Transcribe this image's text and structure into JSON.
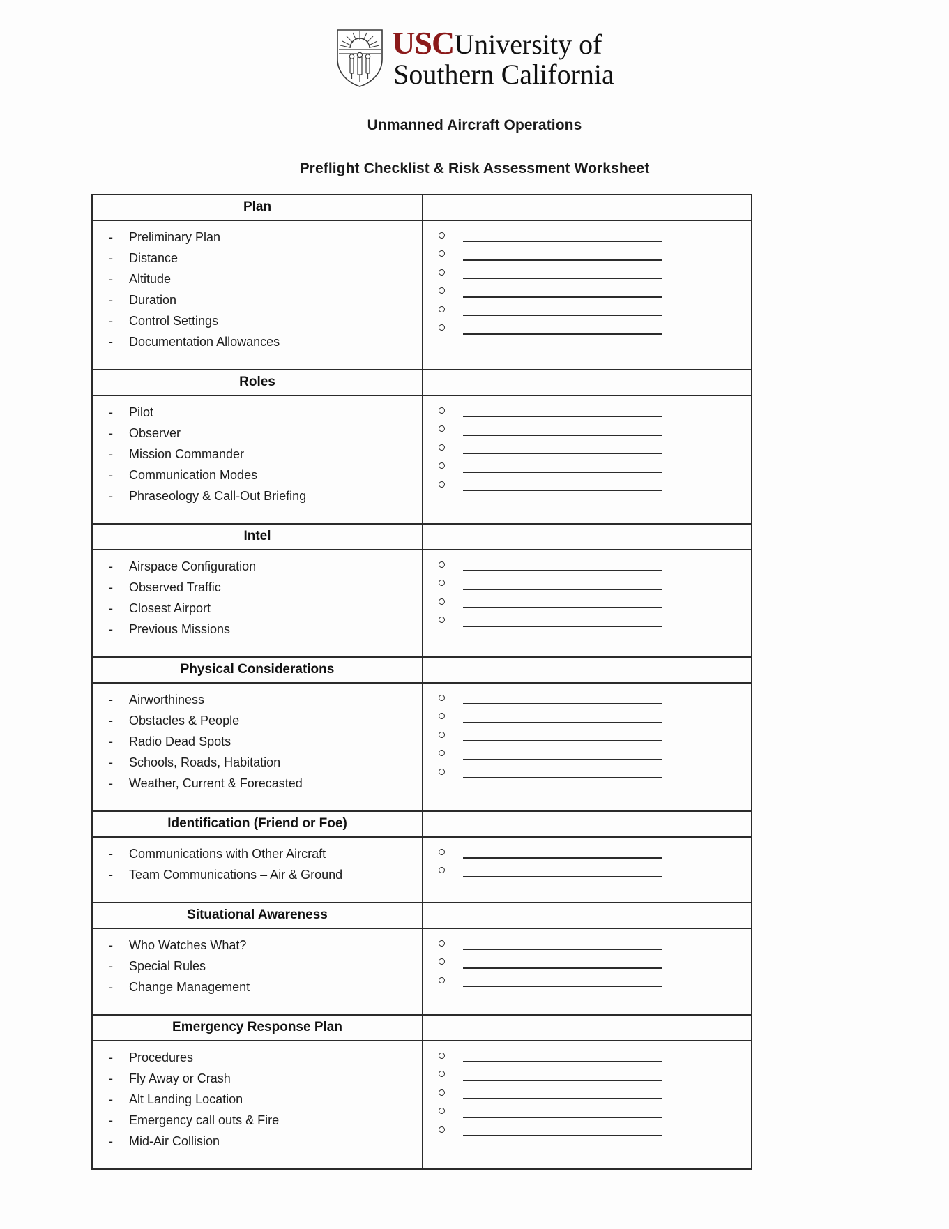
{
  "logo": {
    "usc_letters": "USC",
    "line1_rest": "University of",
    "line2": "Southern California",
    "shield_icon": "usc-shield-icon",
    "brand_color": "#8b1a1a"
  },
  "header": {
    "title": "Unmanned Aircraft Operations",
    "subtitle": "Preflight Checklist & Risk Assessment Worksheet"
  },
  "bullet_dash": "-",
  "sections": [
    {
      "heading": "Plan",
      "items": [
        "Preliminary Plan",
        "Distance",
        "Altitude",
        "Duration",
        "Control Settings",
        "Documentation Allowances"
      ],
      "blanks": 6
    },
    {
      "heading": "Roles",
      "items": [
        "Pilot",
        "Observer",
        "Mission Commander",
        "Communication Modes",
        "Phraseology & Call-Out Briefing"
      ],
      "blanks": 5
    },
    {
      "heading": "Intel",
      "items": [
        "Airspace Configuration",
        "Observed Traffic",
        "Closest Airport",
        "Previous Missions"
      ],
      "blanks": 4
    },
    {
      "heading": "Physical Considerations",
      "items": [
        "Airworthiness",
        "Obstacles & People",
        "Radio Dead Spots",
        "Schools, Roads, Habitation",
        "Weather, Current & Forecasted"
      ],
      "blanks": 5
    },
    {
      "heading": "Identification (Friend or Foe)",
      "items": [
        "Communications with Other Aircraft",
        "Team Communications – Air & Ground"
      ],
      "blanks": 2
    },
    {
      "heading": "Situational Awareness",
      "items": [
        "Who Watches What?",
        "Special Rules",
        "Change Management"
      ],
      "blanks": 3
    },
    {
      "heading": "Emergency Response Plan",
      "items": [
        "Procedures",
        "Fly Away or Crash",
        "Alt Landing Location",
        "Emergency call outs & Fire",
        "Mid-Air Collision"
      ],
      "blanks": 5
    }
  ]
}
